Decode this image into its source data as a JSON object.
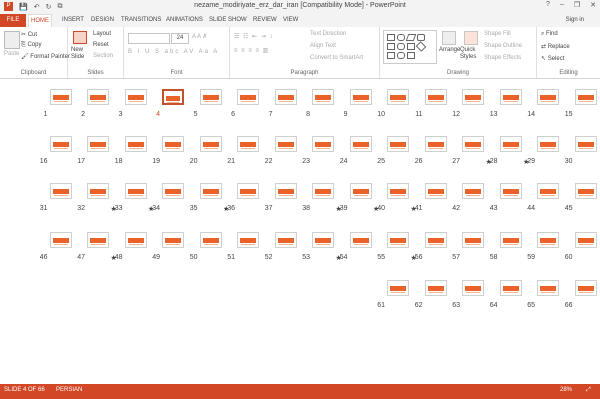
{
  "window": {
    "title": "nezame_modiriyate_erz_dar_iran [Compatibility Mode] - PowerPoint",
    "help": "?",
    "minimize": "–",
    "restore": "❐",
    "close": "✕"
  },
  "qat": {
    "save": "💾",
    "undo": "↶",
    "redo": "↻",
    "present": "⧉"
  },
  "tabs": [
    "FILE",
    "HOME",
    "INSERT",
    "DESIGN",
    "TRANSITIONS",
    "ANIMATIONS",
    "SLIDE SHOW",
    "REVIEW",
    "VIEW"
  ],
  "signin": "Sign in",
  "ribbon": {
    "clipboard": {
      "label": "Clipboard",
      "paste": "Paste",
      "cut": "Cut",
      "copy": "Copy",
      "format_painter": "Format Painter"
    },
    "slides": {
      "label": "Slides",
      "new_slide": "New Slide",
      "layout": "Layout",
      "reset": "Reset",
      "section": "Section"
    },
    "font": {
      "label": "Font",
      "size": "24"
    },
    "paragraph": {
      "label": "Paragraph",
      "text_direction": "Text Direction",
      "align_text": "Align Text",
      "convert": "Convert to SmartArt"
    },
    "drawing": {
      "label": "Drawing",
      "arrange": "Arrange",
      "quick_styles": "Quick Styles",
      "shape_fill": "Shape Fill",
      "shape_outline": "Shape Outline",
      "shape_effects": "Shape Effects"
    },
    "editing": {
      "label": "Editing",
      "find": "Find",
      "replace": "Replace",
      "select": "Select"
    }
  },
  "slides": [
    {
      "n": "15"
    },
    {
      "n": "14"
    },
    {
      "n": "13"
    },
    {
      "n": "12"
    },
    {
      "n": "11"
    },
    {
      "n": "10"
    },
    {
      "n": "9"
    },
    {
      "n": "8"
    },
    {
      "n": "7"
    },
    {
      "n": "6"
    },
    {
      "n": "5"
    },
    {
      "n": "4",
      "selected": true
    },
    {
      "n": "3"
    },
    {
      "n": "2"
    },
    {
      "n": "1"
    },
    {
      "n": "30"
    },
    {
      "n": "29",
      "star": true
    },
    {
      "n": "28",
      "star": true
    },
    {
      "n": "27"
    },
    {
      "n": "26"
    },
    {
      "n": "25"
    },
    {
      "n": "24"
    },
    {
      "n": "23"
    },
    {
      "n": "22"
    },
    {
      "n": "21"
    },
    {
      "n": "20"
    },
    {
      "n": "19"
    },
    {
      "n": "18"
    },
    {
      "n": "17"
    },
    {
      "n": "16"
    },
    {
      "n": "45"
    },
    {
      "n": "44"
    },
    {
      "n": "43"
    },
    {
      "n": "42"
    },
    {
      "n": "41",
      "star": true
    },
    {
      "n": "40",
      "star": true
    },
    {
      "n": "39",
      "star": true
    },
    {
      "n": "38"
    },
    {
      "n": "37"
    },
    {
      "n": "36",
      "star": true
    },
    {
      "n": "35"
    },
    {
      "n": "34",
      "star": true
    },
    {
      "n": "33",
      "star": true
    },
    {
      "n": "32"
    },
    {
      "n": "31"
    },
    {
      "n": "60"
    },
    {
      "n": "59"
    },
    {
      "n": "58"
    },
    {
      "n": "57"
    },
    {
      "n": "56",
      "star": true
    },
    {
      "n": "55"
    },
    {
      "n": "54",
      "star": true
    },
    {
      "n": "53"
    },
    {
      "n": "52"
    },
    {
      "n": "51"
    },
    {
      "n": "50"
    },
    {
      "n": "49"
    },
    {
      "n": "48",
      "star": true
    },
    {
      "n": "47"
    },
    {
      "n": "46"
    },
    {
      "n": "66"
    },
    {
      "n": "65"
    },
    {
      "n": "64"
    },
    {
      "n": "63"
    },
    {
      "n": "62"
    },
    {
      "n": "61"
    }
  ],
  "status": {
    "slide": "SLIDE 4 OF 66",
    "language": "PERSIAN",
    "zoom": "28%",
    "zoom_fit": "⤢"
  }
}
